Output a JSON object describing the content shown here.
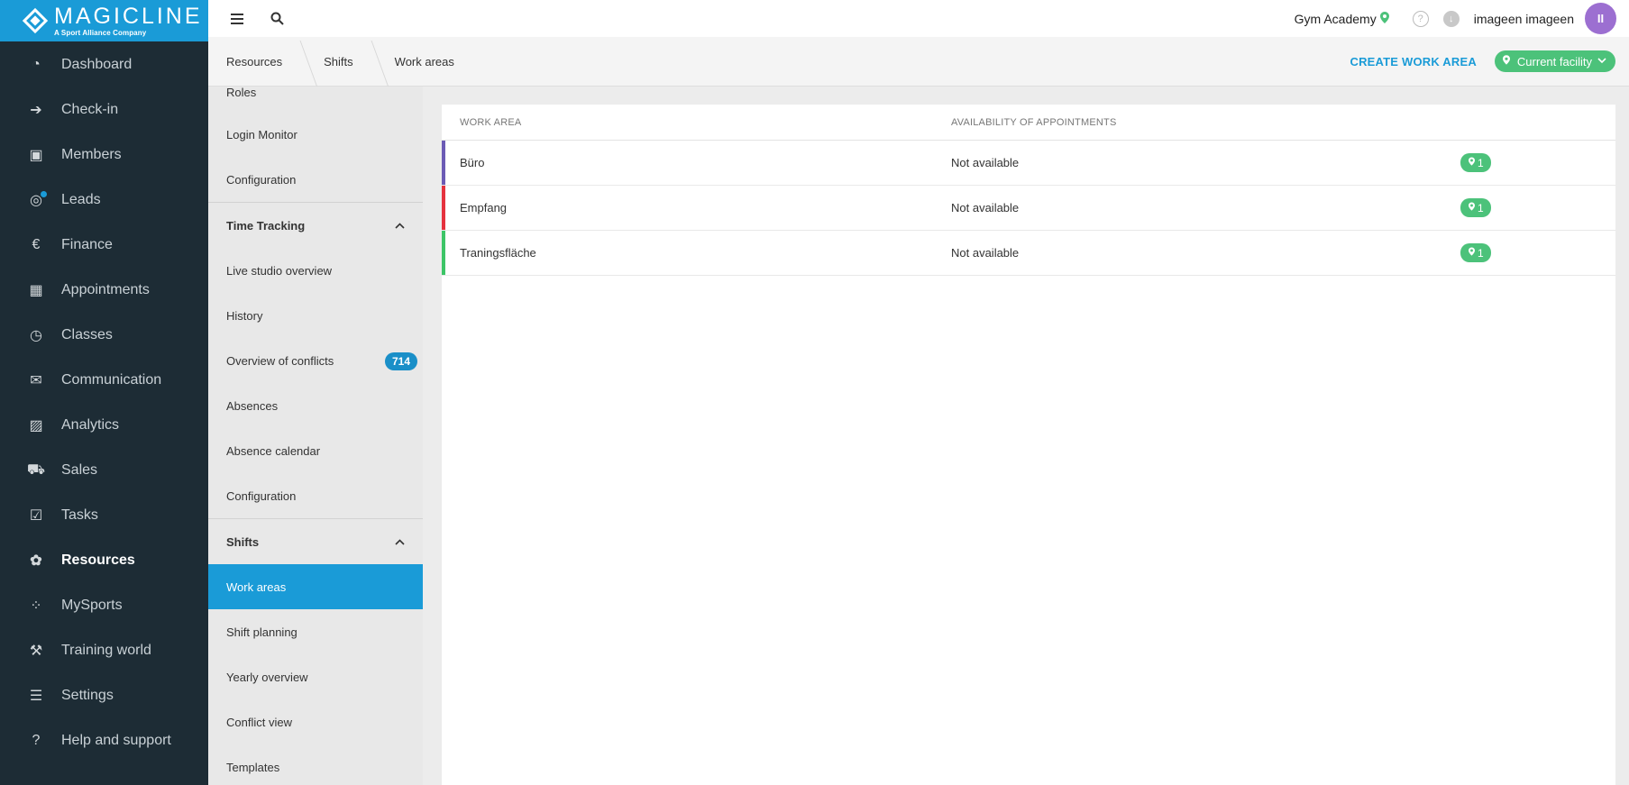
{
  "brand": {
    "name": "MAGICLINE",
    "tagline": "A Sport Alliance Company"
  },
  "sidebar": {
    "items": [
      {
        "label": "Dashboard",
        "icon": "dashboard-icon",
        "glyph": "◔"
      },
      {
        "label": "Check-in",
        "icon": "check-in-icon",
        "glyph": "➔"
      },
      {
        "label": "Members",
        "icon": "members-icon",
        "glyph": "▣"
      },
      {
        "label": "Leads",
        "icon": "leads-icon",
        "glyph": "◎"
      },
      {
        "label": "Finance",
        "icon": "finance-icon",
        "glyph": "€"
      },
      {
        "label": "Appointments",
        "icon": "calendar-icon",
        "glyph": "▦"
      },
      {
        "label": "Classes",
        "icon": "stopwatch-icon",
        "glyph": "◷"
      },
      {
        "label": "Communication",
        "icon": "chat-icon",
        "glyph": "✉"
      },
      {
        "label": "Analytics",
        "icon": "analytics-icon",
        "glyph": "▨"
      },
      {
        "label": "Sales",
        "icon": "cart-icon",
        "glyph": "⛟"
      },
      {
        "label": "Tasks",
        "icon": "task-check-icon",
        "glyph": "☑"
      },
      {
        "label": "Resources",
        "icon": "resources-icon",
        "glyph": "✿"
      },
      {
        "label": "MySports",
        "icon": "mysports-icon",
        "glyph": "⁘"
      },
      {
        "label": "Training world",
        "icon": "dumbbell-icon",
        "glyph": "⚒"
      },
      {
        "label": "Settings",
        "icon": "sliders-icon",
        "glyph": "☰"
      },
      {
        "label": "Help and support",
        "icon": "help-chat-icon",
        "glyph": "?"
      }
    ],
    "active": "Resources"
  },
  "topbar": {
    "studio": "Gym Academy",
    "user": "imageen imageen",
    "avatar_initials": "II"
  },
  "breadcrumb": [
    "Resources",
    "Shifts",
    "Work areas"
  ],
  "actions": {
    "create": "CREATE WORK AREA",
    "facility": "Current facility"
  },
  "subnav": {
    "top_items": [
      "Roles",
      "Login Monitor",
      "Configuration"
    ],
    "time_tracking": {
      "title": "Time Tracking",
      "items": [
        "Live studio overview",
        "History",
        "Overview of conflicts",
        "Absences",
        "Absence calendar",
        "Configuration"
      ],
      "conflicts_badge": "714"
    },
    "shifts": {
      "title": "Shifts",
      "items": [
        "Work areas",
        "Shift planning",
        "Yearly overview",
        "Conflict view",
        "Templates"
      ],
      "active": "Work areas"
    }
  },
  "table": {
    "headers": [
      "WORK AREA",
      "AVAILABILITY OF APPOINTMENTS"
    ],
    "rows": [
      {
        "name": "Büro",
        "availability": "Not available",
        "facilities": "1",
        "color": "#6c5bb5"
      },
      {
        "name": "Empfang",
        "availability": "Not available",
        "facilities": "1",
        "color": "#e5323e"
      },
      {
        "name": "Traningsfläche",
        "availability": "Not available",
        "facilities": "1",
        "color": "#3dc567"
      }
    ]
  },
  "colors": {
    "brand_blue": "#1a9bd7",
    "sidebar_dark": "#1d2c35",
    "accent_green": "#4cc27a"
  }
}
